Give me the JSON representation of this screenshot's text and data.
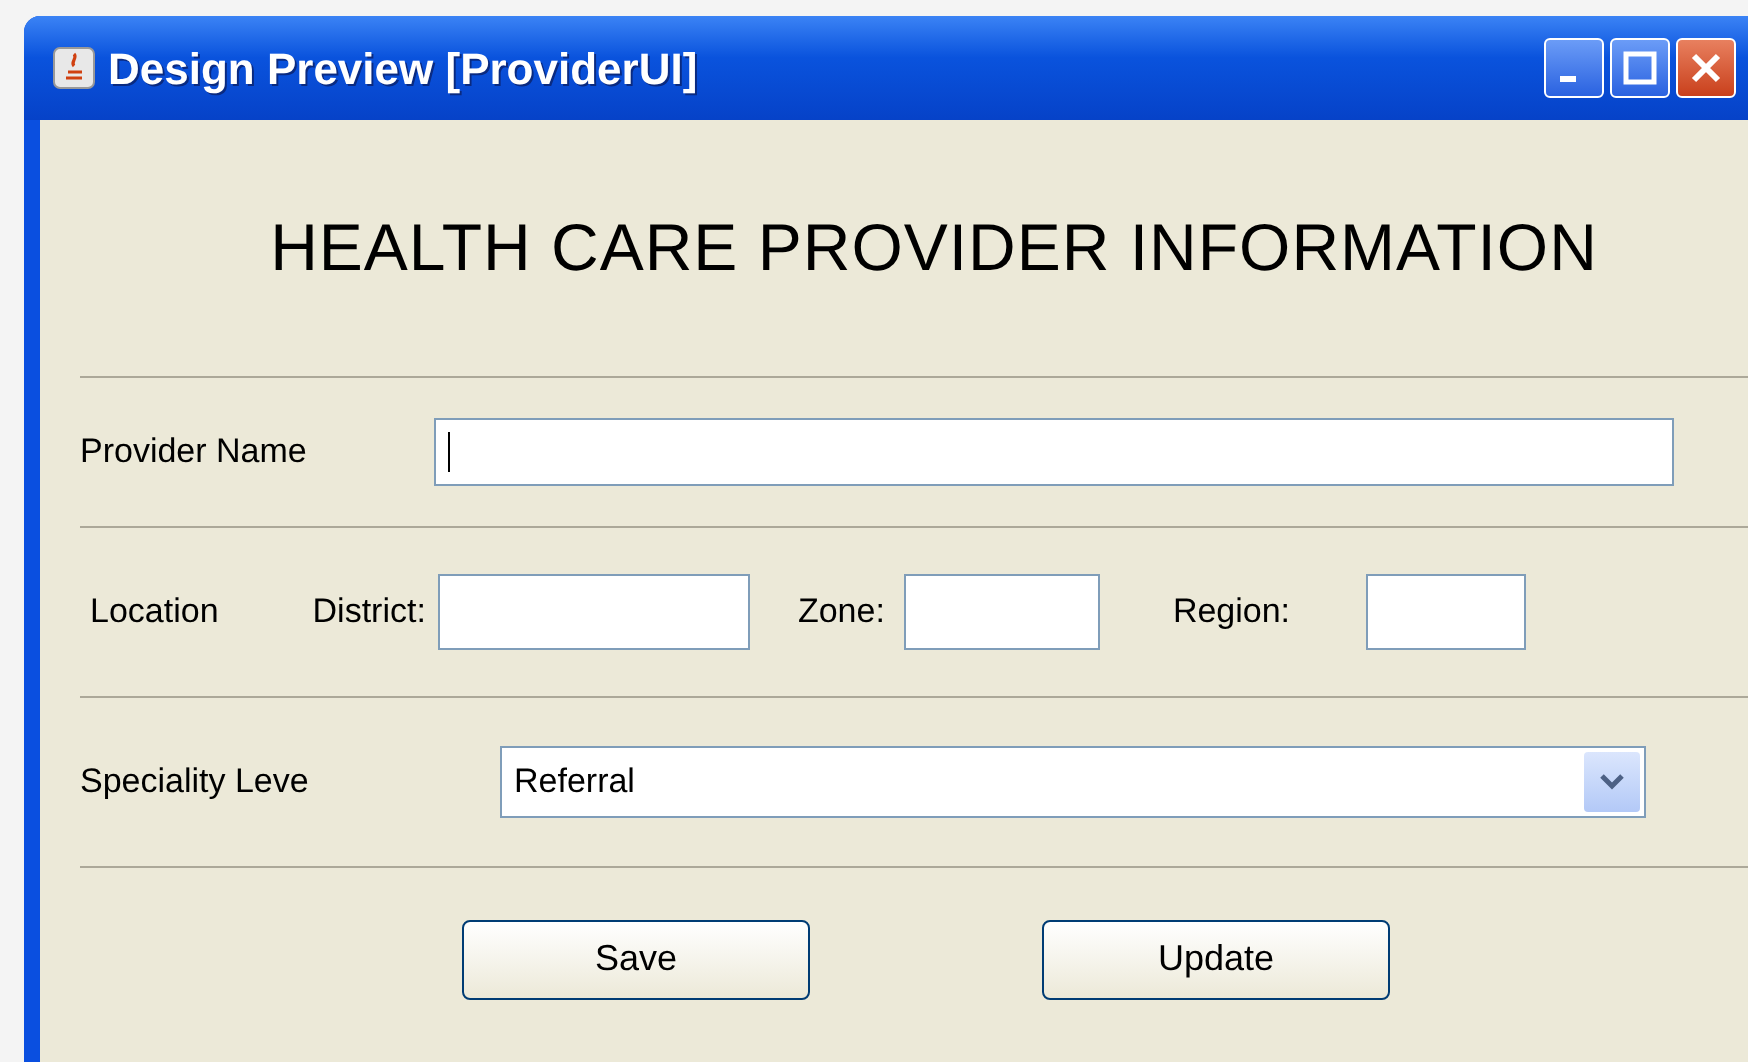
{
  "window": {
    "title": "Design Preview [ProviderUI]"
  },
  "heading": "HEALTH CARE PROVIDER INFORMATION",
  "provider_name": {
    "label": "Provider Name",
    "focused": true
  },
  "location": {
    "label": "Location",
    "fields": [
      {
        "label": "District:"
      },
      {
        "label": "Zone:"
      },
      {
        "label": "Region:"
      }
    ]
  },
  "speciality": {
    "label": "Speciality Leve",
    "value": "Referral"
  },
  "buttons": [
    "Save",
    "Update"
  ]
}
